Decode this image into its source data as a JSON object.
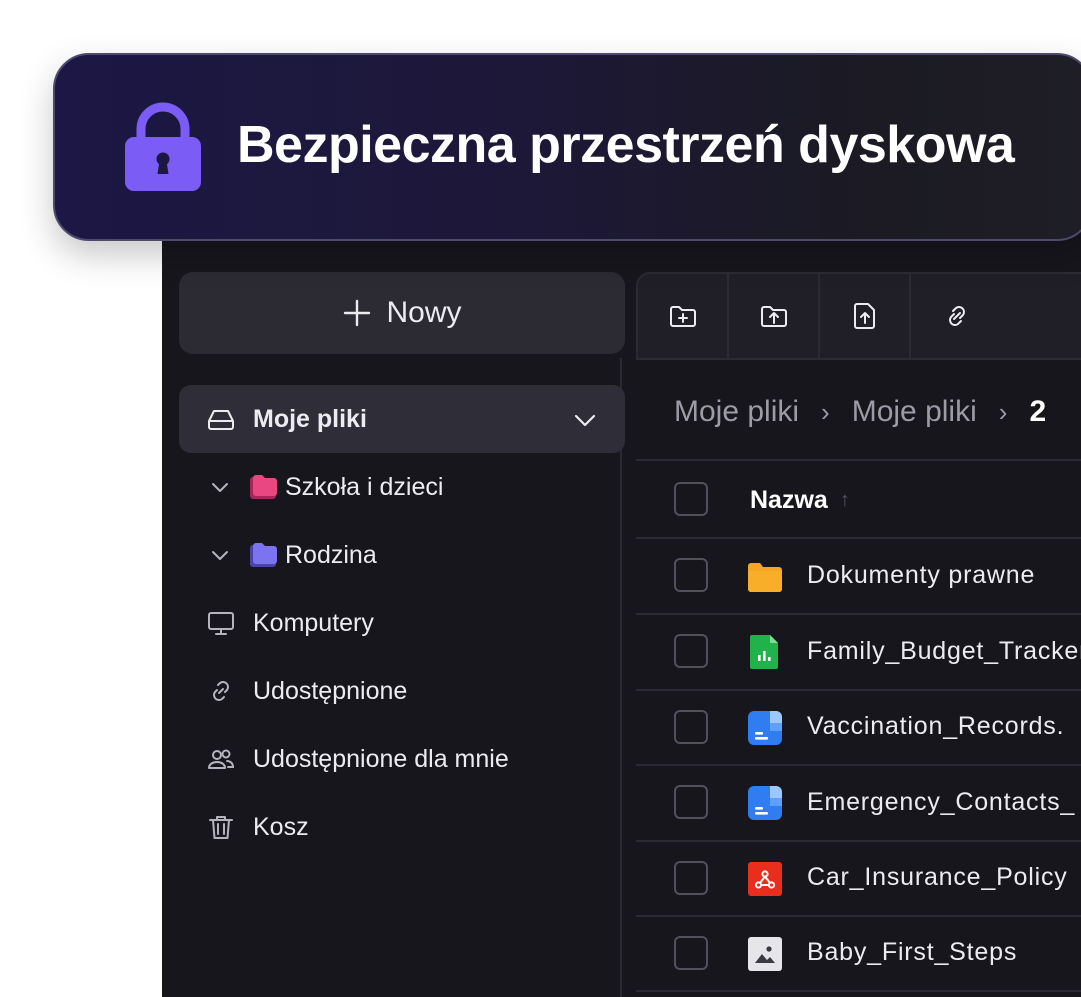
{
  "banner": {
    "title": "Bezpieczna przestrzeń dyskowa",
    "icon": "lock-icon",
    "accent": "#7b5cf5"
  },
  "sidebar": {
    "new_label": "Nowy",
    "items": [
      {
        "label": "Moje pliki",
        "icon": "drive-icon"
      },
      {
        "label": "Szkoła i dzieci",
        "icon": "folder-icon",
        "color": "#e8477f"
      },
      {
        "label": "Rodzina",
        "icon": "folder-icon",
        "color": "#7b73f0"
      },
      {
        "label": "Komputery",
        "icon": "monitor-icon"
      },
      {
        "label": "Udostępnione",
        "icon": "link-icon"
      },
      {
        "label": "Udostępnione dla mnie",
        "icon": "users-icon"
      },
      {
        "label": "Kosz",
        "icon": "trash-icon"
      }
    ]
  },
  "toolbar": {
    "buttons": [
      "new-folder-icon",
      "upload-folder-icon",
      "upload-file-icon",
      "link-icon"
    ]
  },
  "breadcrumb": [
    "Moje pliki",
    "Moje pliki",
    "2"
  ],
  "table": {
    "column_name": "Nazwa",
    "rows": [
      {
        "name": "Dokumenty prawne",
        "type": "folder-icon"
      },
      {
        "name": "Family_Budget_Tracker",
        "type": "spreadsheet-icon"
      },
      {
        "name": "Vaccination_Records.",
        "type": "document-icon"
      },
      {
        "name": "Emergency_Contacts_",
        "type": "document-icon"
      },
      {
        "name": "Car_Insurance_Policy",
        "type": "pdf-icon"
      },
      {
        "name": "Baby_First_Steps",
        "type": "image-icon"
      }
    ]
  }
}
